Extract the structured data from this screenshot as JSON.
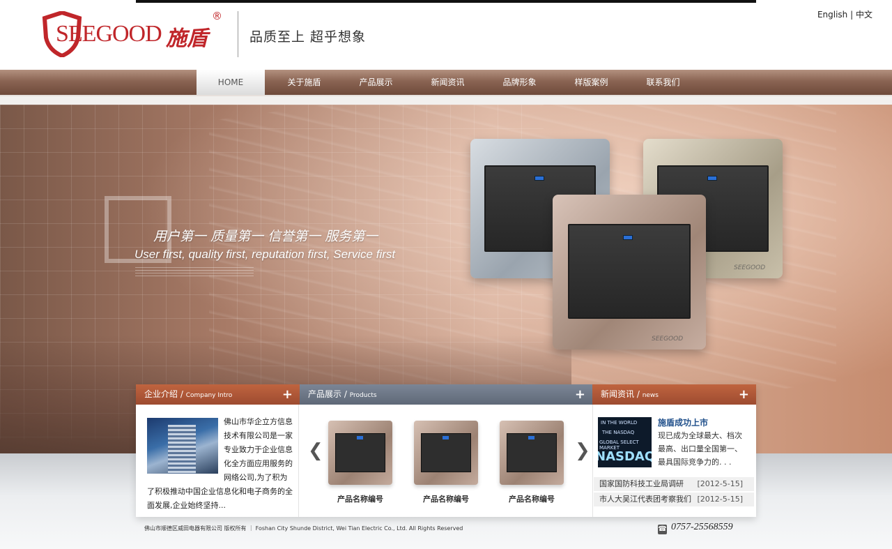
{
  "header": {
    "brand_en": "SEEGOOD",
    "brand_cn": "施盾",
    "registered": "®",
    "slogan": "品质至上 超乎想象",
    "lang_en": "English",
    "lang_sep": "|",
    "lang_cn": "中文"
  },
  "nav": {
    "items": [
      {
        "label": "HOME"
      },
      {
        "label": "关于施盾"
      },
      {
        "label": "产品展示"
      },
      {
        "label": "新闻资讯"
      },
      {
        "label": "品牌形象"
      },
      {
        "label": "样版案例"
      },
      {
        "label": "联系我们"
      }
    ]
  },
  "banner": {
    "motto_cn": "用户第一 质量第一 信誉第一 服务第一",
    "motto_en": "User first, quality first, reputation first, Service first",
    "switch_mark": "SEEGOOD"
  },
  "panels": {
    "intro": {
      "title_cn": "企业介绍",
      "title_en": "Company Intro",
      "plus": "+",
      "text": "佛山市华企立方信息技术有限公司是一家专业致力于企业信息化全方面应用服务的网络公司,为了积为了积极推动中国企业信息化和电子商务的全面发展,企业始终坚持..."
    },
    "products": {
      "title_cn": "产品展示",
      "title_en": "Products",
      "plus": "+",
      "prev": "❮",
      "next": "❯",
      "items": [
        {
          "name": "产品名称编号"
        },
        {
          "name": "产品名称编号"
        },
        {
          "name": "产品名称编号"
        }
      ]
    },
    "news": {
      "title_cn": "新闻资讯",
      "title_en": "news",
      "plus": "+",
      "image_text_1": "IN THE WORLD",
      "image_text_2": "THE NASDAQ",
      "image_text_3": "GLOBAL SELECT MARKET",
      "image_text_4": "NASDAQ",
      "headline": "施盾成功上市",
      "summary": "现已成为全球最大、档次最高、出口量全国第一、最具国际竞争力的. . .",
      "list": [
        {
          "title": "国家国防科技工业局调研",
          "date": "[2012-5-15]"
        },
        {
          "title": "市人大吴江代表团考察我们",
          "date": "[2012-5-15]"
        }
      ]
    }
  },
  "footer": {
    "copyright": "佛山市顺德区威田电器有限公司 版权所有 ｜ Foshan City Shunde District, Wei Tian Electric Co., Ltd. All Rights Reserved",
    "phone": "0757-25568559"
  }
}
